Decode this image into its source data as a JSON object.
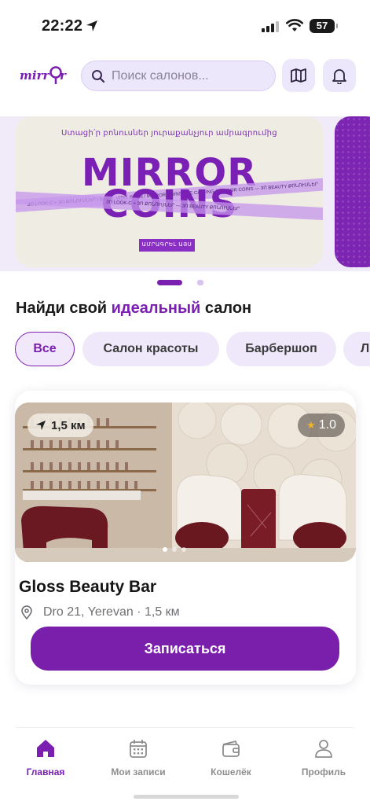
{
  "status": {
    "time": "22:22",
    "battery": "57"
  },
  "header": {
    "logo_text": "mirror",
    "search_placeholder": "Поиск салонов...",
    "icons": {
      "map": "map-icon",
      "bell": "bell-icon",
      "search": "search-icon"
    }
  },
  "banner": {
    "subtitle": "Ստացի՛ր բոնուսներ յուրաքանչյուր ամրագրումից",
    "title_line1": "MIRROR",
    "title_line2": "COINS",
    "ribbon_text_1": "ЗП LOOK-С + ЗП ՔՈՆՈՒՍՆԵՐ / BOOK. VISIT. EARN / MIRROR COINS ARE CALLING / MIRROR COINS — ЗП BEAUTY ՔՈՆՈՒՍՆԵՐ",
    "ribbon_text_2": "ЗП LOOK-С + ЗП ՔՈՆՈՒՍՆԵՐ — ЗП BEAUTY ՔՈՆՈՒՍՆԵՐ",
    "cta": "ԱՄՐԱԳՐԵԼ ԱՅՍ"
  },
  "carousel": {
    "active_index": 0,
    "count": 2
  },
  "section": {
    "title_before": "Найди свой ",
    "title_accent": "идеальный",
    "title_after": " салон"
  },
  "chips": [
    {
      "label": "Все",
      "active": true
    },
    {
      "label": "Салон красоты",
      "active": false
    },
    {
      "label": "Барбершоп",
      "active": false
    },
    {
      "label": "Л",
      "active": false
    }
  ],
  "salon": {
    "distance": "1,5 км",
    "rating": "1.0",
    "name": "Gloss Beauty Bar",
    "address": "Dro 21, Yerevan · 1,5 км",
    "book_label": "Записаться"
  },
  "tabs": [
    {
      "label": "Главная",
      "icon": "home-icon",
      "active": true
    },
    {
      "label": "Мои записи",
      "icon": "calendar-icon",
      "active": false
    },
    {
      "label": "Кошелёк",
      "icon": "wallet-icon",
      "active": false
    },
    {
      "label": "Профиль",
      "icon": "profile-icon",
      "active": false
    }
  ],
  "colors": {
    "brand": "#7a1fb0",
    "chip_bg": "#efe8fa",
    "button": "#7a1fab"
  }
}
